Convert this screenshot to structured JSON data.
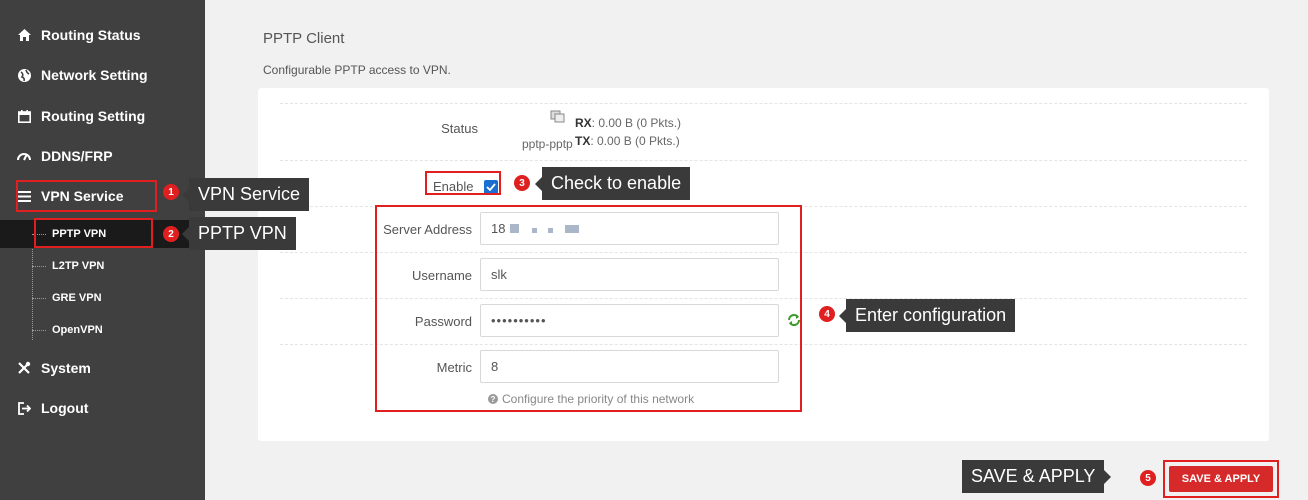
{
  "sidebar": {
    "items": [
      {
        "label": "Routing Status",
        "icon": "home-icon"
      },
      {
        "label": "Network Setting",
        "icon": "globe-icon"
      },
      {
        "label": "Routing Setting",
        "icon": "calendar-icon"
      },
      {
        "label": "DDNS/FRP",
        "icon": "dashboard-icon"
      },
      {
        "label": "VPN Service",
        "icon": "list-icon"
      },
      {
        "label": "System",
        "icon": "tools-icon"
      },
      {
        "label": "Logout",
        "icon": "logout-icon"
      }
    ],
    "sub_items": [
      {
        "label": "PPTP VPN"
      },
      {
        "label": "L2TP VPN"
      },
      {
        "label": "GRE VPN"
      },
      {
        "label": "OpenVPN"
      }
    ]
  },
  "page": {
    "title": "PPTP Client",
    "description": "Configurable PPTP access to VPN."
  },
  "status": {
    "label": "Status",
    "device": "pptp-pptp",
    "rx_key": "RX",
    "rx_value": ": 0.00 B (0 Pkts.)",
    "tx_key": "TX",
    "tx_value": ": 0.00 B (0 Pkts.)"
  },
  "form": {
    "enable_label": "Enable",
    "enabled": true,
    "server_label": "Server Address",
    "server_value": "18",
    "username_label": "Username",
    "username_value": "slk",
    "password_label": "Password",
    "password_value": "••••••••••",
    "metric_label": "Metric",
    "metric_value": "8",
    "metric_hint": "Configure the priority of this network"
  },
  "annotations": {
    "callout_1": "VPN Service",
    "callout_2": "PPTP VPN",
    "callout_3": "Check to enable",
    "callout_4": "Enter configuration",
    "callout_5": "SAVE & APPLY",
    "badges": [
      "1",
      "2",
      "3",
      "4",
      "5"
    ]
  },
  "actions": {
    "save_label": "SAVE & APPLY"
  },
  "colors": {
    "sidebar_bg": "#404040",
    "annotation_red": "#e02020",
    "save_button": "#d62a2a",
    "checkbox_blue": "#1a6fd1"
  }
}
